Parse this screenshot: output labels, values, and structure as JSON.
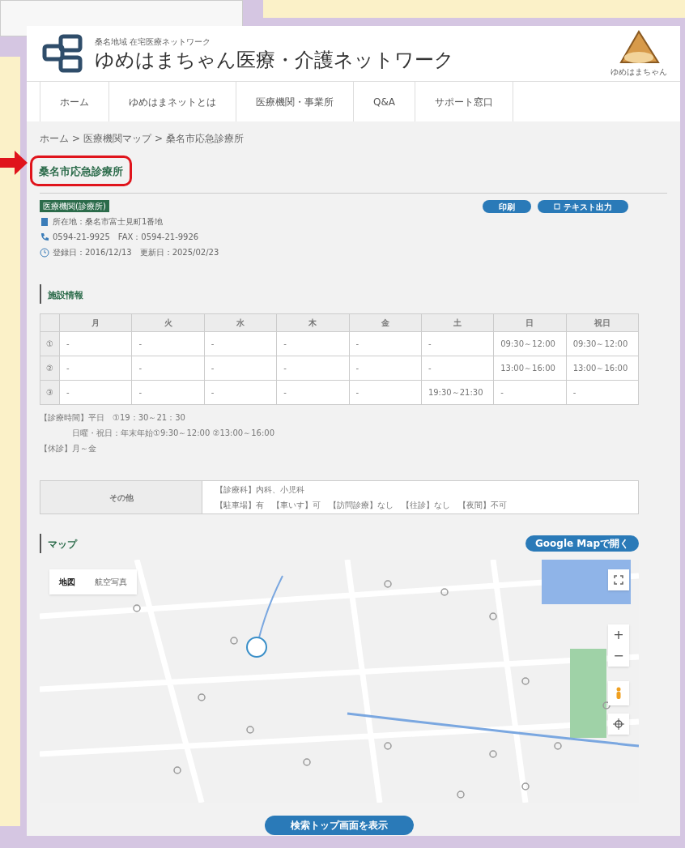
{
  "site": {
    "subtitle": "桑名地域 在宅医療ネットワーク",
    "title": "ゆめはまちゃん医療・介護ネットワーク",
    "mascot_caption": "ゆめはまちゃん"
  },
  "nav": [
    {
      "label": "ホーム"
    },
    {
      "label": "ゆめはまネットとは"
    },
    {
      "label": "医療機関・事業所"
    },
    {
      "label": "Q&A"
    },
    {
      "label": "サポート窓口"
    }
  ],
  "breadcrumb": [
    "ホーム",
    "医療機関マップ",
    "桑名市応急診療所"
  ],
  "breadcrumb_separator": ">",
  "heading": "桑名市応急診療所",
  "badge": "医療機関(診療所)",
  "actions": [
    {
      "label": "印刷",
      "icon": false
    },
    {
      "label": "テキスト出力",
      "icon": true
    }
  ],
  "info": [
    {
      "kind": "address",
      "text": "所在地：桑名市富士見町1番地"
    },
    {
      "kind": "phone",
      "text": "0594-21-9925　FAX：0594-21-9926"
    },
    {
      "kind": "date",
      "text": "登録日：2016/12/13　更新日：2025/02/23"
    }
  ],
  "facility_title": "施設情報",
  "hours": {
    "columns": [
      "月",
      "火",
      "水",
      "木",
      "金",
      "土",
      "日",
      "祝日"
    ],
    "rows": [
      {
        "label": "①",
        "cells": [
          "-",
          "-",
          "-",
          "-",
          "-",
          "-",
          "09:30～12:00",
          "09:30～12:00"
        ]
      },
      {
        "label": "②",
        "cells": [
          "-",
          "-",
          "-",
          "-",
          "-",
          "-",
          "13:00～16:00",
          "13:00～16:00"
        ]
      },
      {
        "label": "③",
        "cells": [
          "-",
          "-",
          "-",
          "-",
          "-",
          "19:30～21:30",
          "-",
          "-"
        ]
      }
    ]
  },
  "notes": [
    "【診療時間】平日　①19：30～21：30",
    "日曜・祝日：年末年始①9:30～12:00 ②13:00～16:00",
    "【休診】月～金"
  ],
  "other": {
    "label": "その他",
    "lines": [
      "【診療科】内科、小児科",
      "【駐車場】有　【車いす】可　【訪問診療】なし　【往診】なし　【夜間】不可"
    ]
  },
  "map_title": "マップ",
  "map_button": "Google Mapで開く",
  "map_types": [
    {
      "label": "地図",
      "selected": true
    },
    {
      "label": "航空写真",
      "selected": false
    }
  ],
  "zoom": [
    "+",
    "−"
  ],
  "bottom_button": "検索トップ画面を表示"
}
